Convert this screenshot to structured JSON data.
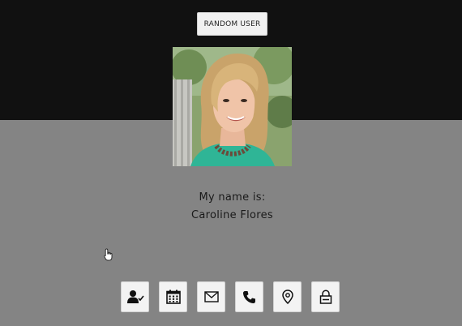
{
  "header": {
    "random_button_label": "Random User"
  },
  "profile": {
    "info_label": "My name is:",
    "info_value": "Caroline Flores"
  },
  "icons": [
    {
      "name": "user-icon"
    },
    {
      "name": "calendar-icon"
    },
    {
      "name": "email-icon"
    },
    {
      "name": "phone-icon"
    },
    {
      "name": "location-icon"
    },
    {
      "name": "lock-icon"
    }
  ],
  "colors": {
    "top_background": "#111111",
    "bottom_background": "#848484",
    "button_background": "#f3f3f3"
  }
}
